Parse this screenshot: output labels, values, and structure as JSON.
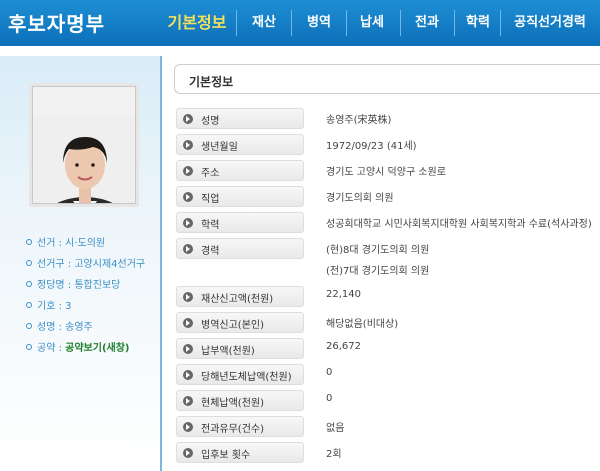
{
  "header": {
    "title": "후보자명부",
    "tabs": [
      {
        "label": "기본정보",
        "active": true
      },
      {
        "label": "재산",
        "active": false
      },
      {
        "label": "병역",
        "active": false
      },
      {
        "label": "납세",
        "active": false
      },
      {
        "label": "전과",
        "active": false
      },
      {
        "label": "학력",
        "active": false
      },
      {
        "label": "공직선거경력",
        "active": false
      }
    ]
  },
  "sidebar": {
    "items": [
      {
        "key": "선거",
        "value": "시·도의원"
      },
      {
        "key": "선거구",
        "value": "고양시제4선거구"
      },
      {
        "key": "정당명",
        "value": "통합진보당"
      },
      {
        "key": "기호",
        "value": "3"
      },
      {
        "key": "성명",
        "value": "송영주"
      },
      {
        "key": "공약",
        "value": "공약보기(새창)"
      }
    ]
  },
  "main": {
    "section_title": "기본정보",
    "rows": [
      {
        "label": "성명",
        "values": [
          "송영주(宋英株)"
        ]
      },
      {
        "label": "생년월일",
        "values": [
          "1972/09/23 (41세)"
        ]
      },
      {
        "label": "주소",
        "values": [
          "경기도 고양시 덕양구 소원로"
        ]
      },
      {
        "label": "직업",
        "values": [
          "경기도의회 의원"
        ]
      },
      {
        "label": "학력",
        "values": [
          "성공회대학교 시민사회복지대학원 사회복지학과 수료(석사과정)"
        ]
      },
      {
        "label": "경력",
        "values": [
          "(현)8대 경기도의회 의원",
          "(전)7대 경기도의회 의원"
        ]
      },
      {
        "label": "재산신고액(천원)",
        "values": [
          "22,140"
        ]
      },
      {
        "label": "병역신고(본인)",
        "values": [
          "해당없음(비대상)"
        ]
      },
      {
        "label": "납부액(천원)",
        "values": [
          "26,672"
        ]
      },
      {
        "label": "당해년도체납액(천원)",
        "values": [
          "0"
        ]
      },
      {
        "label": "현체납액(천원)",
        "values": [
          "0"
        ]
      },
      {
        "label": "전과유무(건수)",
        "values": [
          "없음"
        ]
      },
      {
        "label": "입후보 횟수",
        "values": [
          "2회"
        ]
      }
    ]
  },
  "colors": {
    "header_blue": "#0c6fb8",
    "active_tab": "#f2e15c",
    "sidebar_text": "#3b8fc6",
    "pledge_link": "#1f7f2a"
  }
}
